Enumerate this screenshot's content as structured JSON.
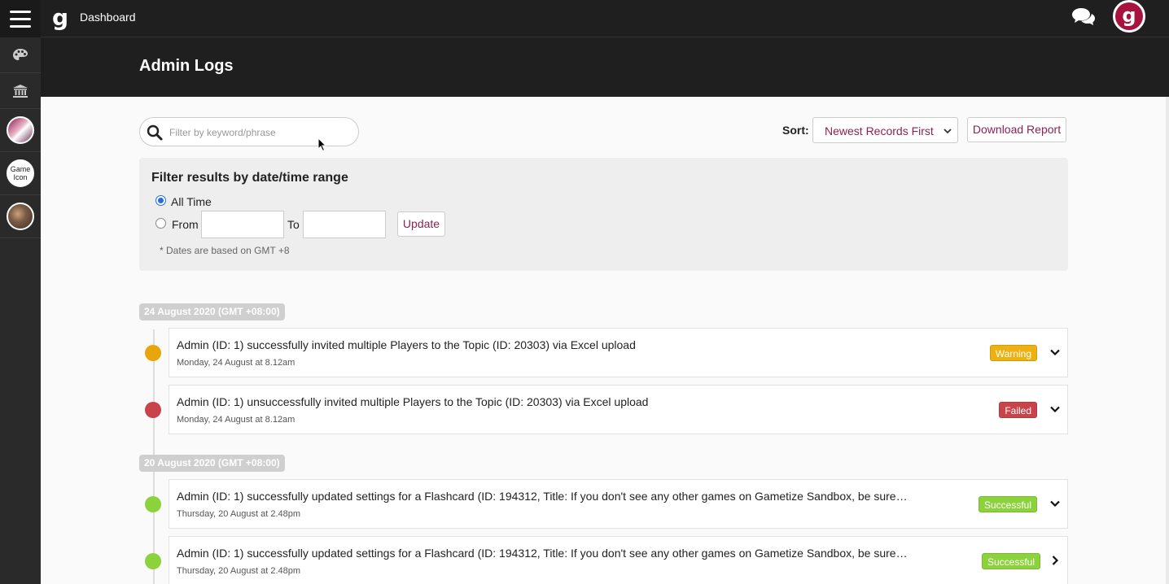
{
  "topbar": {
    "title": "Dashboard",
    "logo_letter": "g",
    "avatar_letter": "g"
  },
  "sidebar": {
    "items": [
      {
        "icon": "palette-icon"
      },
      {
        "icon": "bank-icon"
      },
      {
        "label": ""
      },
      {
        "label": "Game Icon"
      },
      {
        "label": ""
      }
    ]
  },
  "page": {
    "title": "Admin Logs"
  },
  "search": {
    "placeholder": "Filter by keyword/phrase",
    "value": ""
  },
  "sort": {
    "label": "Sort:",
    "selected": "Newest Records First"
  },
  "download": {
    "label": "Download Report"
  },
  "filter": {
    "title": "Filter results by date/time range",
    "all_time": "All Time",
    "from": "From",
    "to": "To",
    "update": "Update",
    "note": "* Dates are based on GMT +8"
  },
  "groups": [
    {
      "date": "24 August 2020 (GMT +08:00)",
      "logs": [
        {
          "text": "Admin (ID: 1) successfully invited multiple Players to the Topic (ID: 20303) via Excel upload",
          "time": "Monday, 24 August at 8.12am",
          "status": "Warning"
        },
        {
          "text": "Admin (ID: 1) unsuccessfully invited multiple Players to the Topic (ID: 20303) via Excel upload",
          "time": "Monday, 24 August at 8.12am",
          "status": "Failed"
        }
      ]
    },
    {
      "date": "20 August 2020 (GMT +08:00)",
      "logs": [
        {
          "text": "Admin (ID: 1) successfully updated settings for a Flashcard (ID: 194312, Title: If you don't see any other games on Gametize Sandbox, be sure…",
          "time": "Thursday, 20 August at 2.48pm",
          "status": "Successful"
        },
        {
          "text": "Admin (ID: 1) successfully updated settings for a Flashcard (ID: 194312, Title: If you don't see any other games on Gametize Sandbox, be sure…",
          "time": "Thursday, 20 August at 2.48pm",
          "status": "Successful"
        }
      ]
    }
  ],
  "colors": {
    "accent": "#8a2252",
    "warning": "#edb211",
    "failed": "#c9434a",
    "success": "#8cd23c",
    "dark": "#1f1f1f"
  }
}
